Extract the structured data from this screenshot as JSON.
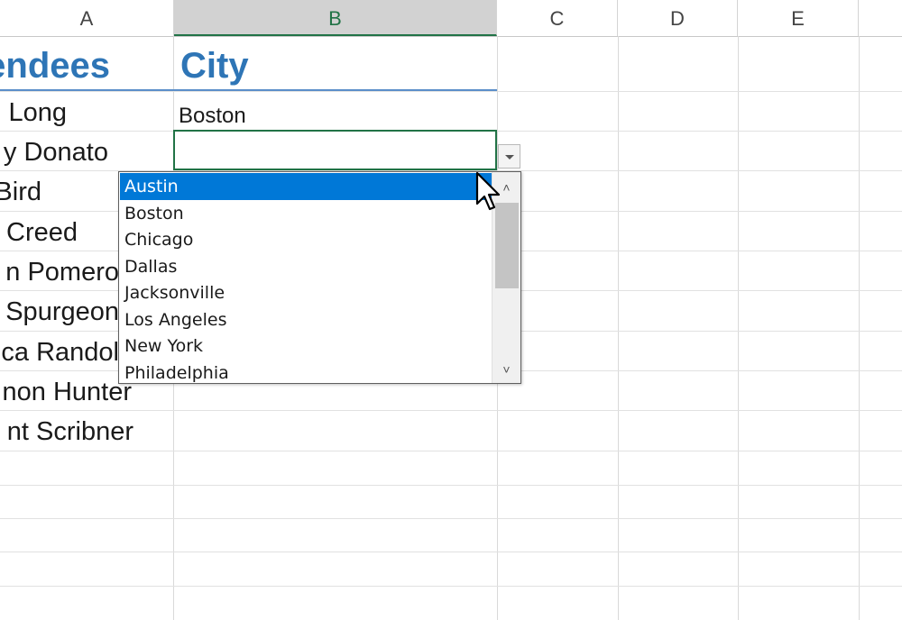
{
  "columns": {
    "a": "A",
    "b": "B",
    "c": "C",
    "d": "D",
    "e": "E"
  },
  "headers": {
    "attendees": "endees",
    "city": "City"
  },
  "attendees": [
    "Long",
    "y Donato",
    "Bird",
    "Creed",
    "n Pomero",
    "Spurgeon",
    "ca Randol",
    "non Hunter",
    "nt Scribner"
  ],
  "cities": {
    "row1": "Boston",
    "row2": ""
  },
  "dropdown": {
    "options": [
      "Austin",
      "Boston",
      "Chicago",
      "Dallas",
      "Jacksonville",
      "Los Angeles",
      "New York",
      "Philadelphia"
    ],
    "highlighted": "Austin"
  },
  "scrollbar": {
    "up_glyph": "˄",
    "down_glyph": "˅"
  },
  "colors": {
    "header_text": "#2e75b6",
    "selection_green": "#217346",
    "highlight_blue": "#0078d7"
  },
  "icons": {
    "dropdown": "chevron-down-icon",
    "cursor": "mouse-pointer-icon"
  }
}
